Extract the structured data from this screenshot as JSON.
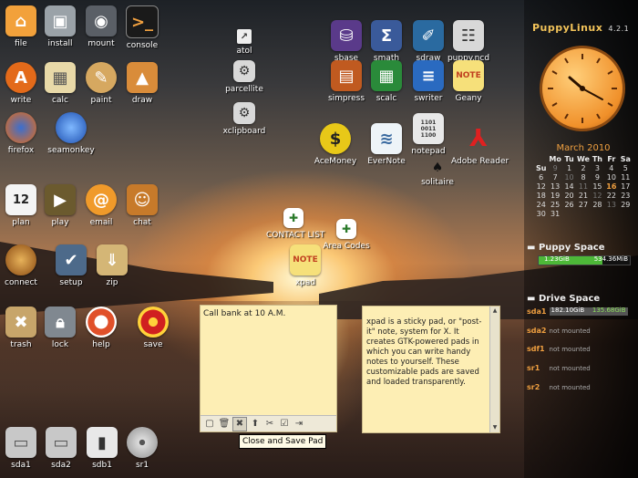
{
  "brand": {
    "name": "PuppyLinux",
    "version": "4.2.1"
  },
  "desktop_icons": [
    {
      "label": "file",
      "icon": "home-icon"
    },
    {
      "label": "install",
      "icon": "install-box-icon"
    },
    {
      "label": "mount",
      "icon": "drive-mount-icon"
    },
    {
      "label": "console",
      "icon": "console-icon"
    },
    {
      "label": "write",
      "icon": "write-icon"
    },
    {
      "label": "calc",
      "icon": "calc-icon"
    },
    {
      "label": "paint",
      "icon": "paint-palette-icon"
    },
    {
      "label": "draw",
      "icon": "draw-icon"
    },
    {
      "label": "firefox",
      "icon": "firefox-icon"
    },
    {
      "label": "seamonkey",
      "icon": "seamonkey-icon"
    },
    {
      "label": "plan",
      "icon": "calendar-12-icon",
      "glyph": "12"
    },
    {
      "label": "play",
      "icon": "film-icon"
    },
    {
      "label": "email",
      "icon": "email-at-icon"
    },
    {
      "label": "chat",
      "icon": "chat-people-icon"
    },
    {
      "label": "connect",
      "icon": "connect-globe-icon"
    },
    {
      "label": "setup",
      "icon": "setup-monitor-icon"
    },
    {
      "label": "zip",
      "icon": "zip-box-icon"
    },
    {
      "label": "trash",
      "icon": "trash-icon"
    },
    {
      "label": "lock",
      "icon": "padlock-icon"
    },
    {
      "label": "help",
      "icon": "lifebuoy-icon"
    },
    {
      "label": "save",
      "icon": "save-target-icon"
    },
    {
      "label": "atol",
      "icon": "atol-icon"
    },
    {
      "label": "parcellite",
      "icon": "gear-icon"
    },
    {
      "label": "xclipboard",
      "icon": "gear-icon"
    },
    {
      "label": "sbase",
      "icon": "sbase-icon"
    },
    {
      "label": "smath",
      "icon": "smath-icon"
    },
    {
      "label": "sdraw",
      "icon": "sdraw-icon"
    },
    {
      "label": "puppy.ncd",
      "icon": "network-icon"
    },
    {
      "label": "simpress",
      "icon": "simpress-icon"
    },
    {
      "label": "scalc",
      "icon": "scalc-icon"
    },
    {
      "label": "swriter",
      "icon": "swriter-icon"
    },
    {
      "label": "Geany",
      "icon": "geany-note-icon"
    },
    {
      "label": "AceMoney",
      "icon": "dollar-coin-icon",
      "glyph": "$"
    },
    {
      "label": "EverNote",
      "icon": "evernote-icon"
    },
    {
      "label": "notepad",
      "icon": "notepad-binary-icon"
    },
    {
      "label": "Adobe Reader",
      "icon": "adobe-reader-icon"
    },
    {
      "label": "solitaire",
      "icon": "spade-icon"
    },
    {
      "label": "CONTACT LIST",
      "icon": "document-link-icon"
    },
    {
      "label": "Area Codes",
      "icon": "document-link-icon"
    },
    {
      "label": "xpad",
      "icon": "xpad-note-icon"
    },
    {
      "label": "sda1",
      "icon": "hard-drive-icon"
    },
    {
      "label": "sda2",
      "icon": "hard-drive-icon"
    },
    {
      "label": "sdb1",
      "icon": "usb-drive-icon"
    },
    {
      "label": "sr1",
      "icon": "cd-icon"
    }
  ],
  "calendar": {
    "title": "March 2010",
    "headers": [
      "Su",
      "Mo",
      "Tu",
      "We",
      "Th",
      "Fr",
      "Sa",
      "Su"
    ],
    "rows": [
      [
        "9",
        "1",
        "2",
        "3",
        "4",
        "5",
        "6",
        "7"
      ],
      [
        "10",
        "8",
        "9",
        "10",
        "11",
        "12",
        "13",
        "14"
      ],
      [
        "11",
        "15",
        "16",
        "17",
        "18",
        "19",
        "20",
        "21"
      ],
      [
        "12",
        "22",
        "23",
        "24",
        "25",
        "26",
        "27",
        "28"
      ],
      [
        "13",
        "29",
        "30",
        "31",
        "",
        "",
        "",
        ""
      ]
    ],
    "today": "16"
  },
  "puppy_space": {
    "title": "Puppy Space",
    "used": "1.23GiB",
    "free": "534.36MiB",
    "fill_fraction": 0.7
  },
  "drive_space": {
    "title": "Drive Space",
    "drives": [
      {
        "name": "sda1",
        "used": "182.10GiB",
        "free": "135.68GiB",
        "mounted": true
      },
      {
        "name": "sda2",
        "status": "not mounted"
      },
      {
        "name": "sdf1",
        "status": "not mounted"
      },
      {
        "name": "sr1",
        "status": "not mounted"
      },
      {
        "name": "sr2",
        "status": "not mounted"
      }
    ]
  },
  "sticky_pad_1": {
    "text": "Call bank at 10 A.M."
  },
  "sticky_pad_2": {
    "text": "xpad is a sticky pad, or \"post-it\" note, system for X. It creates GTK-powered pads in which you can write handy notes to yourself. These customizable pads are saved and loaded transparently."
  },
  "tooltip": {
    "text": "Close and Save Pad"
  }
}
